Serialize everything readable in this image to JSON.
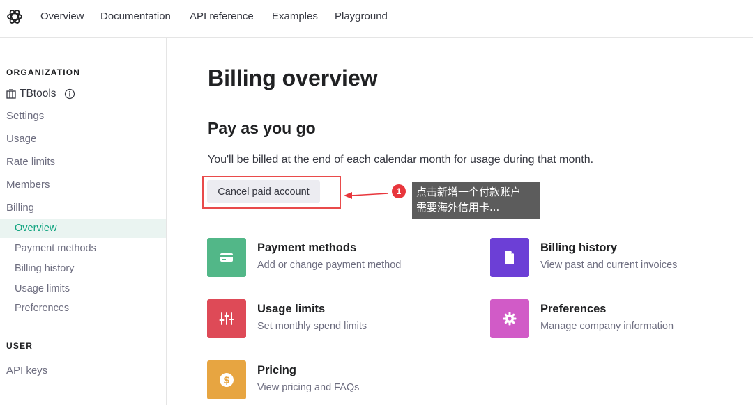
{
  "nav": {
    "logo": "openai-logo-icon",
    "links": [
      "Overview",
      "Documentation",
      "API reference",
      "Examples",
      "Playground"
    ]
  },
  "sidebar": {
    "org_heading": "ORGANIZATION",
    "org_name": "TBtools",
    "items": [
      "Settings",
      "Usage",
      "Rate limits",
      "Members",
      "Billing"
    ],
    "billing_sub": [
      "Overview",
      "Payment methods",
      "Billing history",
      "Usage limits",
      "Preferences"
    ],
    "active_sub": "Overview",
    "user_heading": "USER",
    "user_items": [
      "API keys"
    ]
  },
  "main": {
    "title": "Billing overview",
    "plan_heading": "Pay as you go",
    "plan_desc": "You'll be billed at the end of each calendar month for usage during that month.",
    "cancel_button": "Cancel paid account",
    "annotation": {
      "number": "1",
      "line1": "点击新增一个付款账户",
      "line2": "需要海外信用卡...",
      "color": "#e8363c"
    },
    "cards": [
      {
        "title": "Payment methods",
        "subtitle": "Add or change payment method",
        "icon": "credit-card-icon",
        "color": "#52b788"
      },
      {
        "title": "Billing history",
        "subtitle": "View past and current invoices",
        "icon": "document-icon",
        "color": "#6c3fd6"
      },
      {
        "title": "Usage limits",
        "subtitle": "Set monthly spend limits",
        "icon": "sliders-icon",
        "color": "#de4a57"
      },
      {
        "title": "Preferences",
        "subtitle": "Manage company information",
        "icon": "gear-icon",
        "color": "#d15bc7"
      },
      {
        "title": "Pricing",
        "subtitle": "View pricing and FAQs",
        "icon": "dollar-icon",
        "color": "#e7a541"
      }
    ]
  }
}
